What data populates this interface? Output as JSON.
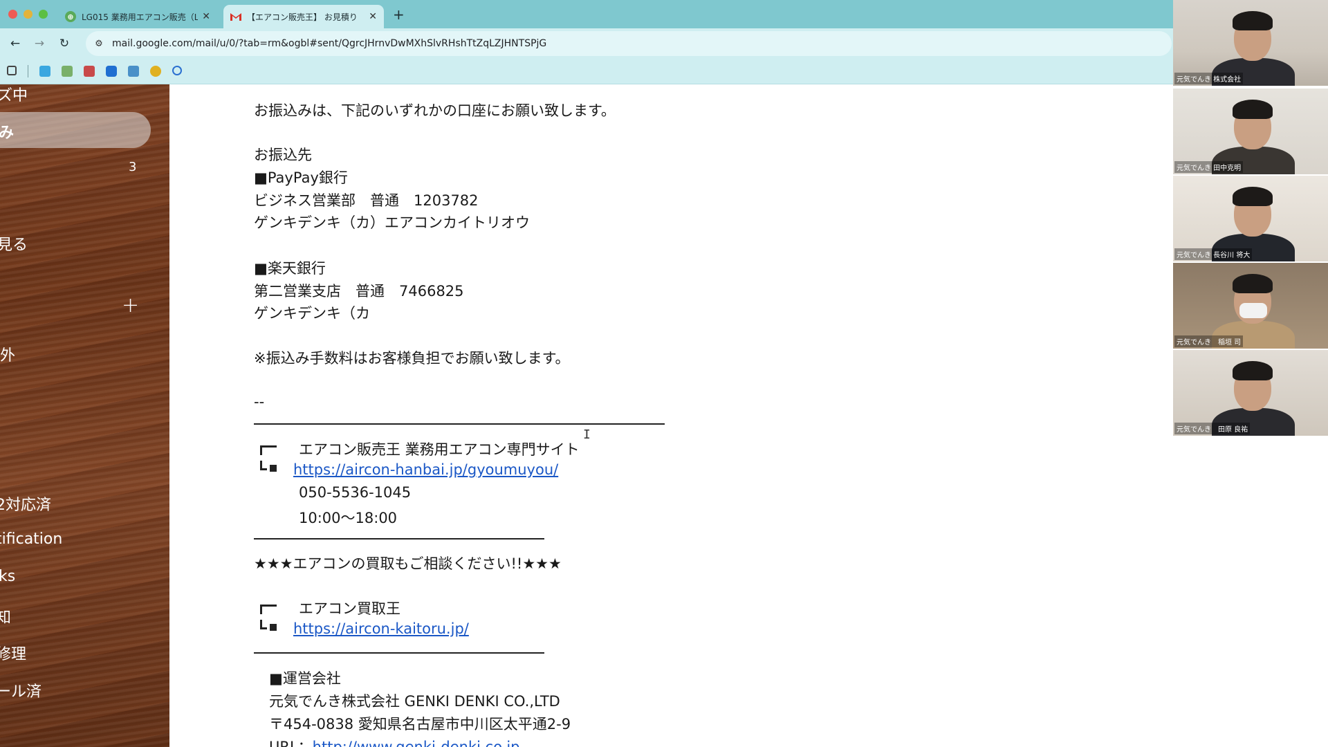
{
  "browser": {
    "tabs": [
      {
        "title": "LG015 業務用エアコン販売（L",
        "favicon": "lg-favicon-icon",
        "active": false
      },
      {
        "title": "【エアコン販売王】 お見積り",
        "favicon": "gmail-icon",
        "active": true
      }
    ],
    "url": "mail.google.com/mail/u/0/?tab=rm&ogbl#sent/QgrcJHrnvDwMXhSlvRHshTtZqLZJHNTSPjG"
  },
  "sidebar": {
    "items": [
      {
        "label": "ズ中"
      },
      {
        "label": "み",
        "active": true
      },
      {
        "label": "",
        "count": "3"
      },
      {
        "label": "見る"
      },
      {
        "label": ""
      },
      {
        "label": "外"
      },
      {
        "label": "2対応済"
      },
      {
        "label": "tification"
      },
      {
        "label": "ks"
      },
      {
        "label": "知"
      },
      {
        "label": "修理"
      },
      {
        "label": "ール済"
      }
    ],
    "plus": "+"
  },
  "mail": {
    "lines": [
      "お振込みは、下記のいずれかの口座にお願い致します。",
      "お振込先",
      "■PayPay銀行",
      "ビジネス営業部　普通　1203782",
      "ゲンキデンキ（カ）エアコンカイトリオウ",
      "■楽天銀行",
      "第二営業支店　普通　7466825",
      "ゲンキデンキ（カ",
      "※振込み手数料はお客様負担でお願い致します。",
      "--"
    ],
    "signature": {
      "site_name": "エアコン販売王 業務用エアコン専門サイト",
      "site_url": "https://aircon-hanbai.jp/gyoumuyou/",
      "phone": "050-5536-1045",
      "hours": "10:00〜18:00",
      "promo": "★★★エアコンの買取もご相談ください!!★★★",
      "buy_name": "エアコン買取王",
      "buy_url": "https://aircon-kaitoru.jp/",
      "company_heading": "■運営会社",
      "company_name": "元気でんき株式会社 GENKI DENKI CO.,LTD",
      "address": "〒454-0838 愛知県名古屋市中川区太平通2-9",
      "url_label": "URL：",
      "company_url": "http://www.genki-denki.co.jp"
    }
  },
  "participants": [
    {
      "name": "元気でんき 株式会社",
      "mask": false
    },
    {
      "name": "元気でんき 田中克明",
      "mask": false
    },
    {
      "name": "元気でんき 長谷川 将大",
      "mask": false
    },
    {
      "name": "元気でんき　稲垣 司",
      "mask": true
    },
    {
      "name": "元気でんき　田原 良祐",
      "mask": false
    }
  ],
  "colors": {
    "chrome_tabstrip": "#7fc8cf",
    "chrome_toolbar": "#cfeef1",
    "link": "#1a57c6"
  }
}
